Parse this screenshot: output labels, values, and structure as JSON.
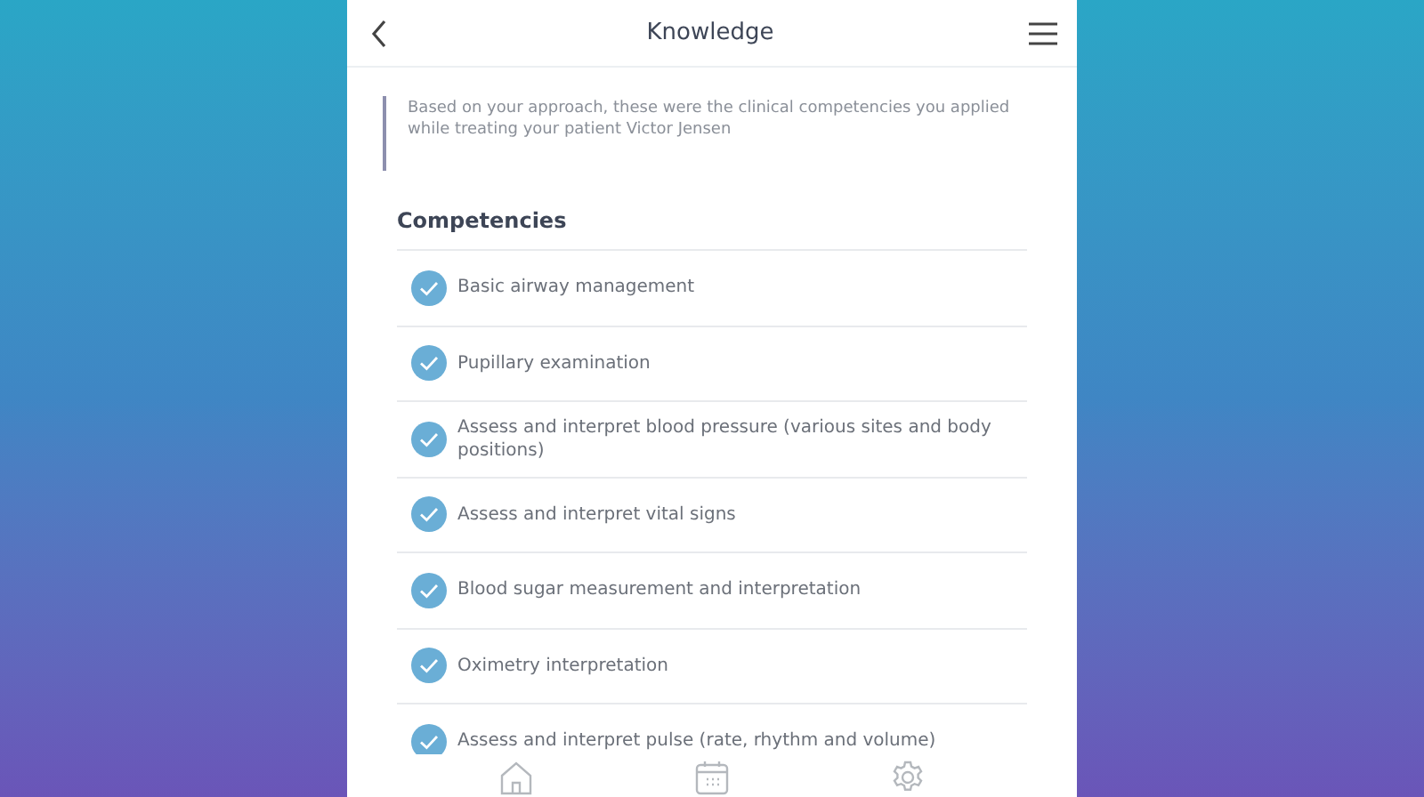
{
  "header": {
    "title": "Knowledge"
  },
  "intro": "Based on your approach, these were the clinical competencies you applied while treating your patient Victor Jensen",
  "section_title": "Competencies",
  "competencies": [
    {
      "label": "Basic airway management",
      "checked": true
    },
    {
      "label": "Pupillary examination",
      "checked": true
    },
    {
      "label": "Assess and interpret blood pressure (various sites and body positions)",
      "checked": true
    },
    {
      "label": "Assess and interpret vital signs",
      "checked": true
    },
    {
      "label": "Blood sugar measurement and interpretation",
      "checked": true
    },
    {
      "label": "Oximetry interpretation",
      "checked": true
    },
    {
      "label": "Assess and interpret pulse (rate, rhythm and volume)",
      "checked": true
    }
  ],
  "nav": [
    {
      "kind": "home"
    },
    {
      "kind": "calendar"
    },
    {
      "kind": "settings"
    }
  ]
}
